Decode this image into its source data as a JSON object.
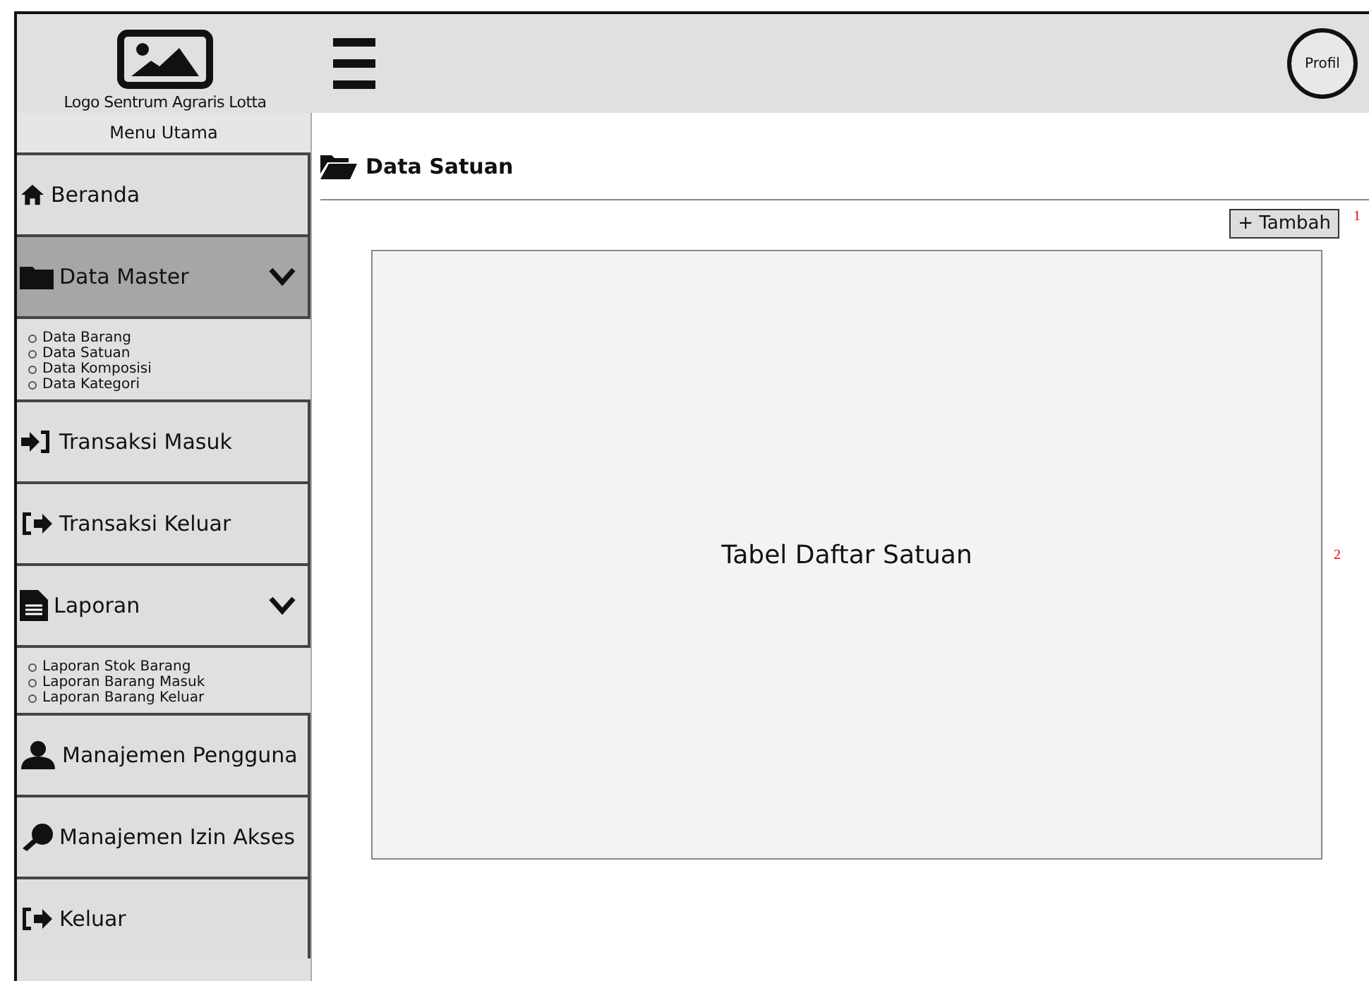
{
  "header": {
    "logo_caption": "Logo Sentrum Agraris Lotta",
    "profile": "Profil"
  },
  "sidebar": {
    "title": "Menu Utama",
    "items": [
      {
        "label": "Beranda",
        "selected": false
      },
      {
        "label": "Data Master",
        "selected": true,
        "expanded": true,
        "children": [
          {
            "label": "Data Barang"
          },
          {
            "label": "Data Satuan"
          },
          {
            "label": "Data Komposisi"
          },
          {
            "label": "Data Kategori"
          }
        ]
      },
      {
        "label": "Transaksi Masuk",
        "selected": false
      },
      {
        "label": "Transaksi Keluar",
        "selected": false
      },
      {
        "label": "Laporan",
        "selected": false,
        "expanded": true,
        "children": [
          {
            "label": "Laporan Stok Barang"
          },
          {
            "label": "Laporan Barang Masuk"
          },
          {
            "label": "Laporan Barang Keluar"
          }
        ]
      },
      {
        "label": "Manajemen Pengguna",
        "selected": false
      },
      {
        "label": "Manajemen Izin Akses",
        "selected": false
      },
      {
        "label": "Keluar",
        "selected": false
      }
    ]
  },
  "page": {
    "title": "Data Satuan",
    "add_button": "+ Tambah",
    "table_placeholder": "Tabel Daftar Satuan"
  },
  "annotations": [
    "1",
    "2"
  ]
}
